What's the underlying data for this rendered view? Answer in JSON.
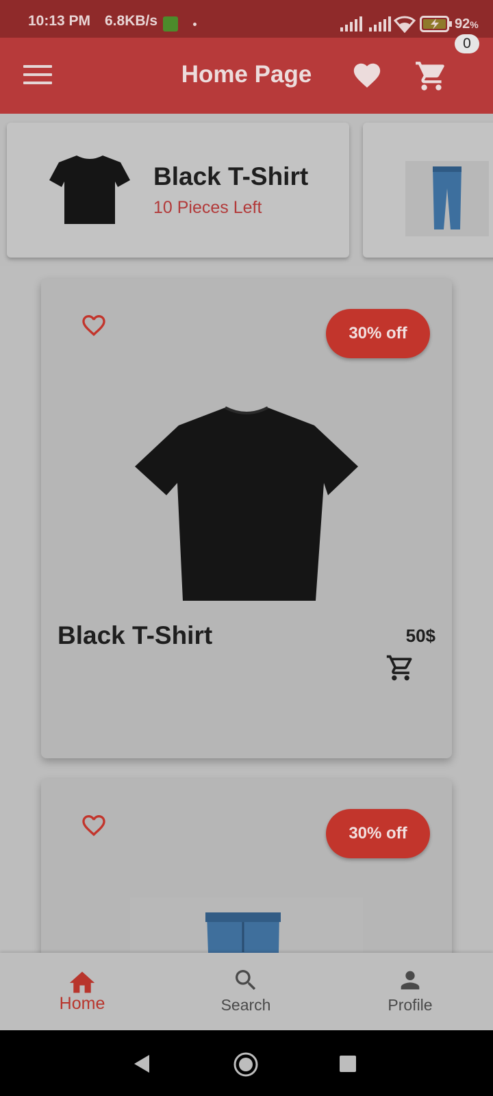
{
  "status_bar": {
    "time": "10:13 PM",
    "net_speed": "6.8KB/s",
    "battery": "92",
    "battery_unit": "%"
  },
  "app_bar": {
    "title": "Home Page",
    "menu_icon": "menu-icon",
    "favorites_icon": "heart-icon",
    "cart_icon": "cart-icon",
    "cart_count": "0"
  },
  "carousel": {
    "items": [
      {
        "title": "Black T-Shirt",
        "stock": "10 Pieces Left",
        "image": "black-tshirt"
      },
      {
        "title": "",
        "stock": "",
        "image": "blue-jeans"
      }
    ]
  },
  "products": [
    {
      "name": "Black T-Shirt",
      "price": "50$",
      "discount": "30% off",
      "image": "black-tshirt"
    },
    {
      "name": "",
      "price": "",
      "discount": "30% off",
      "image": "blue-jeans"
    }
  ],
  "bottom_nav": {
    "items": [
      {
        "label": "Home",
        "icon": "home-icon",
        "active": true
      },
      {
        "label": "Search",
        "icon": "search-icon",
        "active": false
      },
      {
        "label": "Profile",
        "icon": "person-icon",
        "active": false
      }
    ]
  },
  "colors": {
    "primary": "#b73a3a",
    "status_bar": "#8f2a2a",
    "accent_red": "#c2352c",
    "background": "#bdbdbd"
  }
}
